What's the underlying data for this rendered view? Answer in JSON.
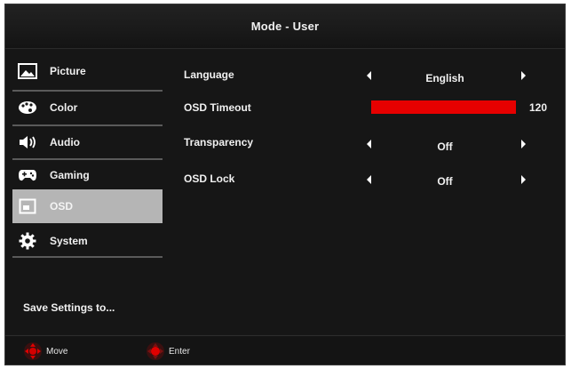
{
  "title": "Mode - User",
  "sidebar": {
    "items": [
      {
        "label": "Picture",
        "icon": "picture-icon"
      },
      {
        "label": "Color",
        "icon": "palette-icon"
      },
      {
        "label": "Audio",
        "icon": "speaker-icon"
      },
      {
        "label": "Gaming",
        "icon": "gamepad-icon"
      },
      {
        "label": "OSD",
        "icon": "osd-icon",
        "selected": true
      },
      {
        "label": "System",
        "icon": "gear-icon"
      }
    ],
    "save_settings": "Save Settings to..."
  },
  "settings": {
    "language": {
      "label": "Language",
      "value": "English"
    },
    "osd_timeout": {
      "label": "OSD Timeout",
      "value": "120",
      "fraction": 1.0
    },
    "transparency": {
      "label": "Transparency",
      "value": "Off"
    },
    "osd_lock": {
      "label": "OSD Lock",
      "value": "Off"
    }
  },
  "footer": {
    "move_label": "Move",
    "enter_label": "Enter"
  },
  "colors": {
    "background": "#171717",
    "selected": "#b5b5b5",
    "accent": "#e60000"
  }
}
